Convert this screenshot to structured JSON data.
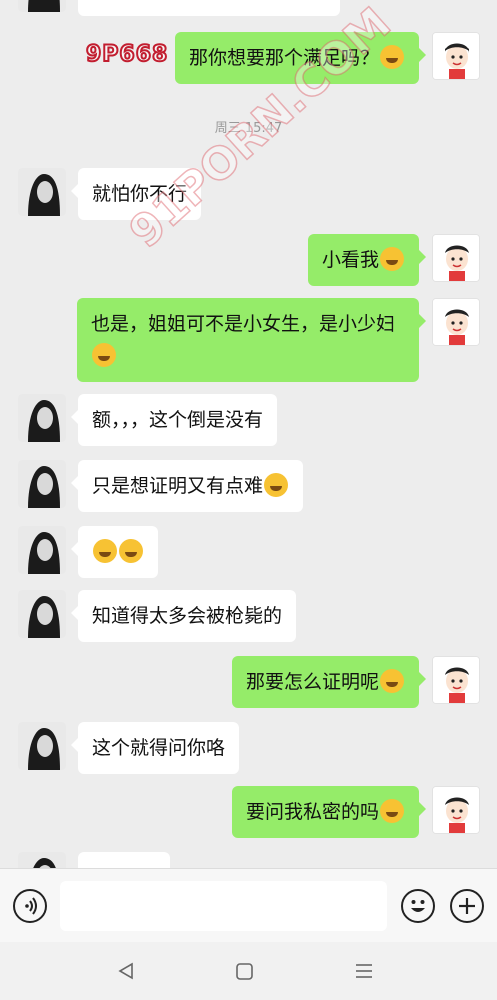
{
  "watermarks": {
    "top": "9P668",
    "diagonal": "91PORN.COM"
  },
  "timestamp": "周三 15:47",
  "messages": [
    {
      "text": "那你想要那个满足吗？"
    },
    {
      "text": "就怕你不行"
    },
    {
      "text": "小看我"
    },
    {
      "text": "也是，姐姐可不是小女生，是小少妇"
    },
    {
      "text": "额，，，这个倒是没有"
    },
    {
      "text": "只是想证明又有点难"
    },
    {
      "text": ""
    },
    {
      "text": "知道得太多会被枪毙的"
    },
    {
      "text": "那要怎么证明呢"
    },
    {
      "text": "这个就得问你咯"
    },
    {
      "text": "要问我私密的吗"
    }
  ],
  "icons": {
    "voice": "voice-input-icon",
    "emoji": "emoji-icon",
    "plus": "plus-icon",
    "back": "nav-back-icon",
    "home": "nav-home-icon",
    "menu": "nav-menu-icon"
  },
  "colors": {
    "sent_bubble": "#95ec69",
    "received_bubble": "#ffffff",
    "background": "#ededed",
    "watermark_stroke": "#c21d2f"
  }
}
